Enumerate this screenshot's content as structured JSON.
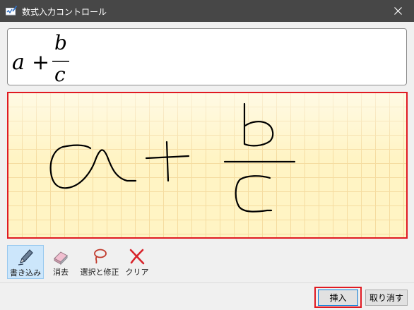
{
  "window": {
    "title": "数式入力コントロール",
    "title_icon": "math-pen-icon",
    "close_icon": "close-icon"
  },
  "preview": {
    "expression": {
      "a": "a",
      "plus": "+",
      "numerator": "b",
      "denominator": "c"
    }
  },
  "tools": {
    "write": {
      "label": "書き込み",
      "icon": "pen-icon",
      "active": true
    },
    "erase": {
      "label": "消去",
      "icon": "eraser-icon"
    },
    "select": {
      "label": "選択と修正",
      "icon": "lasso-icon"
    },
    "clear": {
      "label": "クリア",
      "icon": "clear-x-icon"
    }
  },
  "buttons": {
    "insert": "挿入",
    "cancel": "取り消す"
  },
  "colors": {
    "titlebar": "#474747",
    "highlight_red": "#e01a22",
    "ink_area_bg": "#fff4c4",
    "active_tool_bg": "#cce6fb",
    "clear_icon_red": "#d8232a"
  }
}
